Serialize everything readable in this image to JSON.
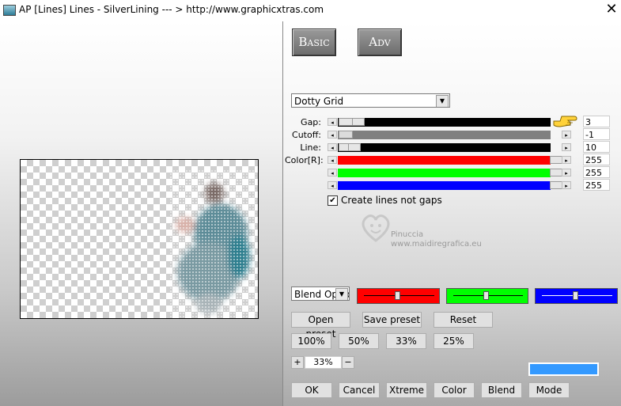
{
  "window": {
    "title": "AP [Lines]  Lines - SilverLining   --- > http://www.graphicxtras.com",
    "close_glyph": "✕"
  },
  "tabs": {
    "basic": "Basic",
    "adv": "Adv"
  },
  "effect_select": {
    "value": "Dotty Grid"
  },
  "sliders": [
    {
      "label": "Gap:",
      "value": "3",
      "fill": "#000000"
    },
    {
      "label": "Cutoff:",
      "value": "-1",
      "fill": "#808080"
    },
    {
      "label": "Line:",
      "value": "10",
      "fill": "#000000"
    },
    {
      "label": "Color[R]:",
      "value": "255",
      "fill": "#ff0000"
    },
    {
      "label": "",
      "value": "255",
      "fill": "#00ff00"
    },
    {
      "label": "",
      "value": "255",
      "fill": "#0000ff"
    }
  ],
  "checkbox": {
    "label": "Create lines not gaps",
    "checked": true,
    "glyph": "✔"
  },
  "watermark": {
    "name": "Pinuccia",
    "site": "www.maidiregrafica.eu"
  },
  "blend_select": {
    "value": "Blend Optio"
  },
  "color_sliders": {
    "red": "#ff0000",
    "green": "#00ff00",
    "blue": "#0000ff"
  },
  "buttons": {
    "open_preset": "Open preset",
    "save_preset": "Save preset",
    "reset": "Reset",
    "zoom_100": "100%",
    "zoom_50": "50%",
    "zoom_33": "33%",
    "zoom_25": "25%",
    "ok": "OK",
    "cancel": "Cancel",
    "xtreme": "Xtreme",
    "color": "Color",
    "blend": "Blend",
    "mode": "Mode"
  },
  "zoom": {
    "plus": "+",
    "value": "33%",
    "minus": "−"
  },
  "swatch_color": "#3399ff",
  "icons": {
    "pointer": "hand-pointer-icon",
    "app": "app-icon",
    "close": "close-icon"
  }
}
